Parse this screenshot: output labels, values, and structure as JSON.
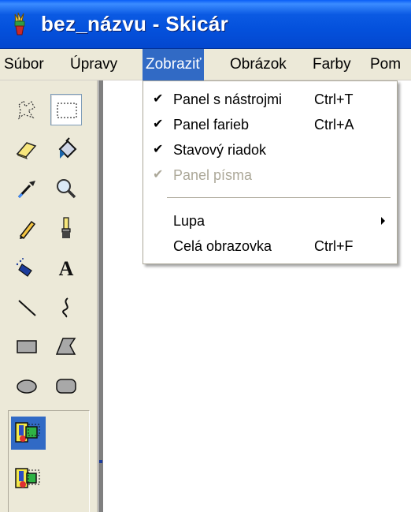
{
  "window": {
    "title": "bez_názvu - Skicár",
    "icon": "paint-app-icon"
  },
  "menubar": {
    "items": [
      {
        "label": "Súbor"
      },
      {
        "label": "Úpravy"
      },
      {
        "label": "Zobraziť"
      },
      {
        "label": "Obrázok"
      },
      {
        "label": "Farby"
      },
      {
        "label": "Pom"
      }
    ],
    "active": "Zobraziť"
  },
  "view_menu": {
    "items": [
      {
        "label": "Panel s nástrojmi",
        "shortcut": "Ctrl+T",
        "checked": true,
        "enabled": true
      },
      {
        "label": "Panel farieb",
        "shortcut": "Ctrl+A",
        "checked": true,
        "enabled": true
      },
      {
        "label": "Stavový riadok",
        "shortcut": "",
        "checked": true,
        "enabled": true
      },
      {
        "label": "Panel písma",
        "shortcut": "",
        "checked": true,
        "enabled": false
      },
      {
        "label": "Lupa",
        "shortcut": "",
        "submenu": true,
        "enabled": true
      },
      {
        "label": "Celá obrazovka",
        "shortcut": "Ctrl+F",
        "enabled": true
      }
    ],
    "check_glyph": "✔"
  },
  "toolbox": {
    "tools": [
      {
        "icon": "free-form-select-icon"
      },
      {
        "icon": "rectangle-select-icon",
        "selected": true
      },
      {
        "icon": "eraser-icon"
      },
      {
        "icon": "fill-bucket-icon"
      },
      {
        "icon": "color-picker-icon"
      },
      {
        "icon": "magnifier-icon"
      },
      {
        "icon": "pencil-icon"
      },
      {
        "icon": "brush-icon"
      },
      {
        "icon": "airbrush-icon"
      },
      {
        "icon": "text-icon",
        "glyph": "A"
      },
      {
        "icon": "line-icon"
      },
      {
        "icon": "curve-icon"
      },
      {
        "icon": "rectangle-icon"
      },
      {
        "icon": "polygon-icon"
      },
      {
        "icon": "ellipse-icon"
      },
      {
        "icon": "rounded-rectangle-icon"
      }
    ],
    "options": [
      {
        "icon": "opaque-selection-icon",
        "selected": true
      },
      {
        "icon": "transparent-selection-icon",
        "selected": false
      }
    ]
  },
  "colors": {
    "title_bar": "#0451dc",
    "menu_highlight": "#316ac5",
    "chrome": "#ece9d8",
    "disabled_text": "#aca899"
  }
}
